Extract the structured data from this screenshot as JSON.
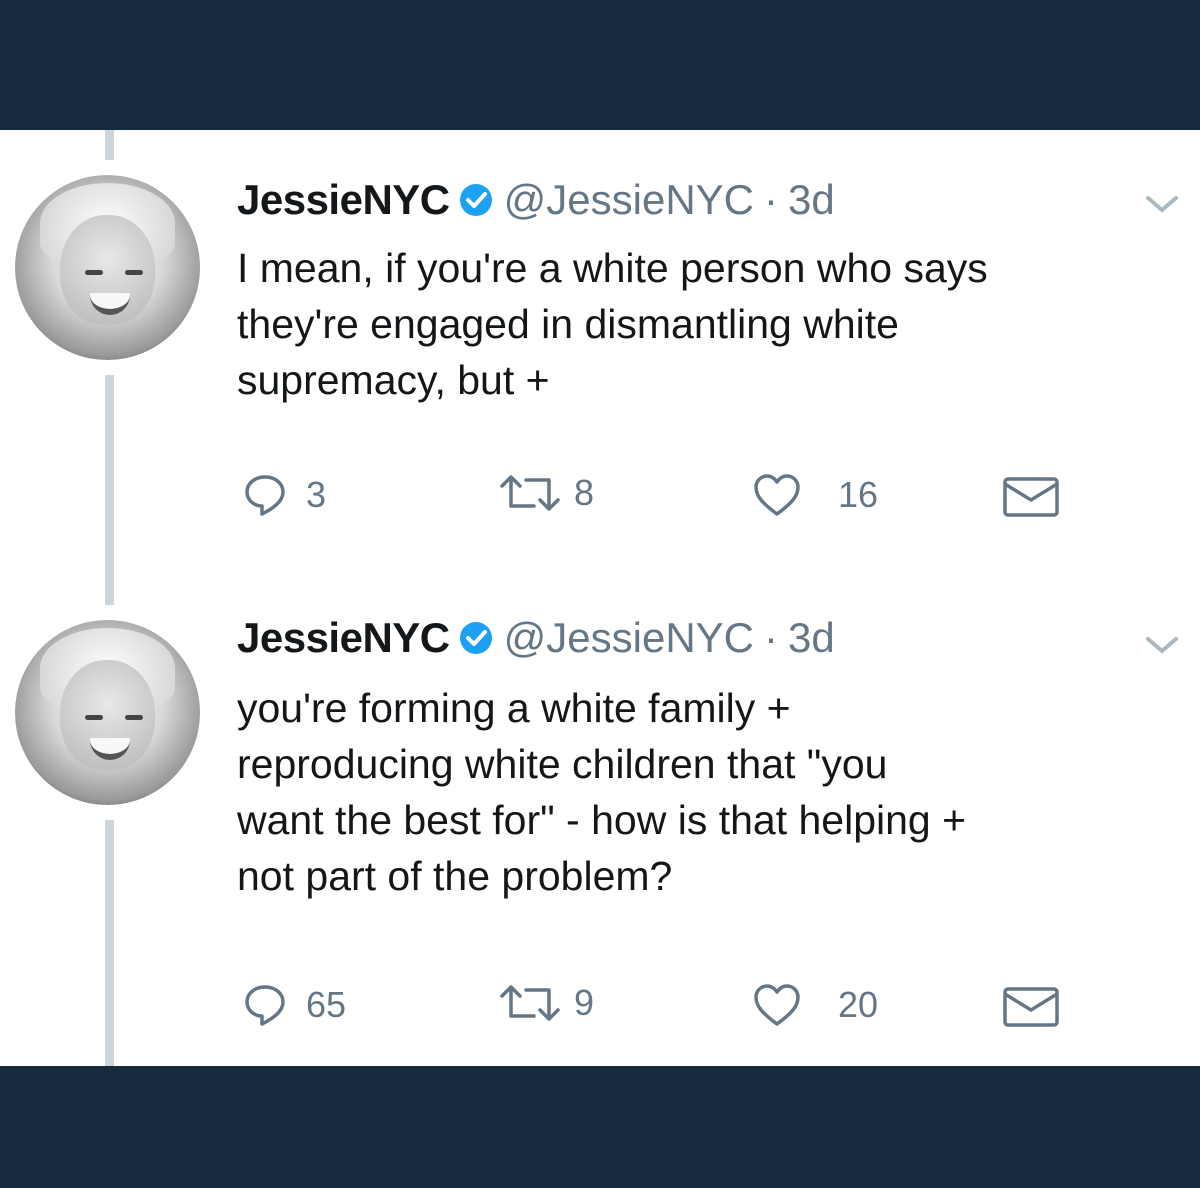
{
  "tweets": [
    {
      "name": "JessieNYC",
      "handle": "@JessieNYC",
      "separator": "·",
      "time": "3d",
      "lines": [
        "I mean, if you're a white person who says",
        "they're engaged in dismantling white",
        "supremacy, but +"
      ],
      "replies": "3",
      "retweets": "8",
      "likes": "16"
    },
    {
      "name": "JessieNYC",
      "handle": "@JessieNYC",
      "separator": "·",
      "time": "3d",
      "lines": [
        "you're forming a white family +",
        "reproducing white children that \"you",
        "want the best for\" - how is that helping +",
        "not part of the problem?"
      ],
      "replies": "65",
      "retweets": "9",
      "likes": "20"
    }
  ],
  "icons": [
    "reply-icon",
    "retweet-icon",
    "like-icon",
    "message-icon",
    "verified-badge-icon",
    "chevron-down-icon"
  ],
  "colors": {
    "band": "#162c3e",
    "verified": "#1da1f2",
    "muted": "#657786",
    "text": "#14171a"
  }
}
